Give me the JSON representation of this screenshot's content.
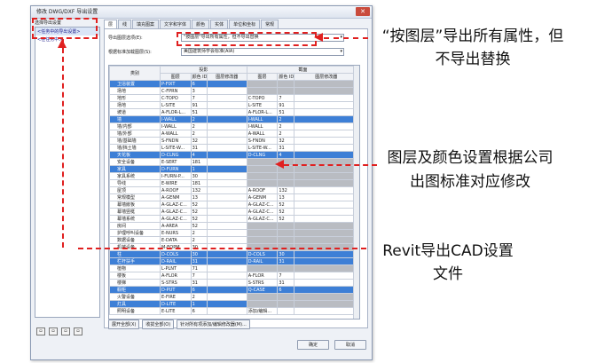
{
  "window": {
    "title": "修改 DWG/DXF 导出设置"
  },
  "left_pane": {
    "label": "选择导出设置",
    "items": [
      "<任务中的导出设置>",
      "<在任务中>"
    ]
  },
  "tabs": [
    "层",
    "线",
    "填充图案",
    "文字和字体",
    "颜色",
    "实体",
    "单位和坐标",
    "常规"
  ],
  "export_layer_options": {
    "label": "导出图层选项(E):",
    "value": "\"按图层\"导出所有属性，但不导出替换"
  },
  "layer_standard": {
    "label": "根据标准加载图层(S):",
    "value": "美国建筑师学会标准(AIA)"
  },
  "grid": {
    "col_category": "类别",
    "group_projection": "投影",
    "group_cut": "截面",
    "col_layer": "图层",
    "col_color_id": "颜色 ID",
    "col_modifier": "图层修改器",
    "rows": [
      {
        "name": "卫浴装置",
        "l1": "P-FIXT",
        "c1": "6",
        "l2": "",
        "c2": "",
        "hl": true
      },
      {
        "name": "场地",
        "l1": "C-FPRN",
        "c1": "3",
        "l2": "",
        "c2": "",
        "hl": false
      },
      {
        "name": "地形",
        "l1": "C-TOPO",
        "c1": "7",
        "l2": "C-TOPO",
        "c2": "7",
        "hl": false
      },
      {
        "name": "场地",
        "l1": "L-SITE",
        "c1": "91",
        "l2": "L-SITE",
        "c2": "91",
        "hl": false
      },
      {
        "name": "坡道",
        "l1": "A-FLOR-L...",
        "c1": "51",
        "l2": "A-FLOR-L...",
        "c2": "51",
        "hl": false
      },
      {
        "name": "墙",
        "l1": "I-WALL",
        "c1": "2",
        "l2": "I-WALL",
        "c2": "2",
        "hl": true
      },
      {
        "name": "墙/内部",
        "l1": "I-WALL",
        "c1": "2",
        "l2": "I-WALL",
        "c2": "2",
        "hl": false
      },
      {
        "name": "墙/外部",
        "l1": "A-WALL",
        "c1": "2",
        "l2": "A-WALL",
        "c2": "2",
        "hl": false
      },
      {
        "name": "墙/基础墙",
        "l1": "S-FNDN",
        "c1": "32",
        "l2": "S-FNDN",
        "c2": "32",
        "hl": false
      },
      {
        "name": "墙/挡土墙",
        "l1": "L-SITE-W...",
        "c1": "31",
        "l2": "L-SITE-W...",
        "c2": "31",
        "hl": false
      },
      {
        "name": "天花板",
        "l1": "D-CLNG",
        "c1": "4",
        "l2": "D-CLNG",
        "c2": "4",
        "hl": true
      },
      {
        "name": "安全设备",
        "l1": "E-SERT",
        "c1": "181",
        "l2": "",
        "c2": "",
        "hl": false
      },
      {
        "name": "家具",
        "l1": "D-FURN",
        "c1": "1",
        "l2": "",
        "c2": "",
        "hl": true
      },
      {
        "name": "家具系统",
        "l1": "I-FURN-P...",
        "c1": "30",
        "l2": "",
        "c2": "",
        "hl": false
      },
      {
        "name": "导线",
        "l1": "E-WIRE",
        "c1": "181",
        "l2": "",
        "c2": "",
        "hl": false
      },
      {
        "name": "屋顶",
        "l1": "A-ROOF",
        "c1": "132",
        "l2": "A-ROOF",
        "c2": "132",
        "hl": false
      },
      {
        "name": "常规模型",
        "l1": "A-GENM",
        "c1": "13",
        "l2": "A-GENM",
        "c2": "13",
        "hl": false
      },
      {
        "name": "幕墙嵌板",
        "l1": "A-GLAZ-C...",
        "c1": "52",
        "l2": "A-GLAZ-C...",
        "c2": "52",
        "hl": false
      },
      {
        "name": "幕墙竖梃",
        "l1": "A-GLAZ-C...",
        "c1": "52",
        "l2": "A-GLAZ-C...",
        "c2": "52",
        "hl": false
      },
      {
        "name": "幕墙系统",
        "l1": "A-GLAZ-C...",
        "c1": "52",
        "l2": "A-GLAZ-C...",
        "c2": "52",
        "hl": false
      },
      {
        "name": "房间",
        "l1": "A-AREA",
        "c1": "52",
        "l2": "",
        "c2": "",
        "hl": false
      },
      {
        "name": "护理呼叫设备",
        "l1": "E-NURS",
        "c1": "2",
        "l2": "",
        "c2": "",
        "hl": false
      },
      {
        "name": "数据设备",
        "l1": "E-DATA",
        "c1": "2",
        "l2": "",
        "c2": "",
        "hl": false
      },
      {
        "name": "机械设备",
        "l1": "M-EQPM",
        "c1": "30",
        "l2": "",
        "c2": "",
        "hl": false
      },
      {
        "name": "柱",
        "l1": "D-COLS",
        "c1": "30",
        "l2": "D-COLS",
        "c2": "30",
        "hl": true
      },
      {
        "name": "栏杆扶手",
        "l1": "D-RAIL",
        "c1": "31",
        "l2": "D-RAIL",
        "c2": "31",
        "hl": true
      },
      {
        "name": "植物",
        "l1": "L-PLNT",
        "c1": "71",
        "l2": "",
        "c2": "",
        "hl": false
      },
      {
        "name": "楼板",
        "l1": "A-FLOR",
        "c1": "7",
        "l2": "A-FLOR",
        "c2": "7",
        "hl": false
      },
      {
        "name": "楼梯",
        "l1": "S-STRS",
        "c1": "31",
        "l2": "S-STRS",
        "c2": "31",
        "hl": false
      },
      {
        "name": "橱柜",
        "l1": "D-PUT",
        "c1": "6",
        "l2": "Q-CASE",
        "c2": "6",
        "hl": true
      },
      {
        "name": "火警设备",
        "l1": "E-FIRE",
        "c1": "2",
        "l2": "",
        "c2": "",
        "hl": false
      },
      {
        "name": "灯具",
        "l1": "D-LITE",
        "c1": "1",
        "l2": "",
        "c2": "",
        "hl": true
      },
      {
        "name": "照明设备",
        "l1": "E-LITE",
        "c1": "6",
        "l2": "添加/编辑...",
        "c2": "",
        "hl": false
      }
    ]
  },
  "buttons": {
    "expand_all": "展开全部(X)",
    "collapse_all": "收拢全部(O)",
    "add_edit_all": "针对所有项添加/编辑修改器(M)...",
    "ok": "确定",
    "cancel": "取消"
  },
  "annotations": {
    "a1": "“按图层”导出所有属性，但不导出替换",
    "a2": "图层及颜色设置根据公司出图标准对应修改",
    "a3": "Revit导出CAD设置文件"
  },
  "colors": {
    "annotation_red": "#e02020",
    "highlight_blue": "#3d7fd6"
  }
}
